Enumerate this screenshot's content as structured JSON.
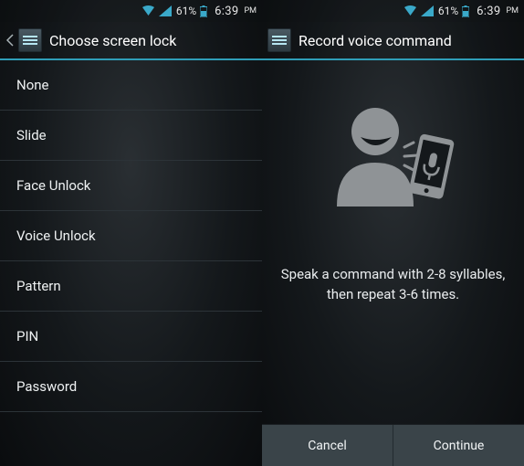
{
  "status": {
    "battery_pct": "61%",
    "time": "6:39",
    "ampm": "PM"
  },
  "left": {
    "title": "Choose screen lock",
    "items": [
      {
        "label": "None"
      },
      {
        "label": "Slide"
      },
      {
        "label": "Face Unlock"
      },
      {
        "label": "Voice Unlock"
      },
      {
        "label": "Pattern"
      },
      {
        "label": "PIN"
      },
      {
        "label": "Password"
      }
    ]
  },
  "right": {
    "title": "Record voice command",
    "instruction_line1": "Speak a command with 2-8 syllables,",
    "instruction_line2": "then repeat 3-6 times.",
    "cancel_label": "Cancel",
    "continue_label": "Continue"
  }
}
